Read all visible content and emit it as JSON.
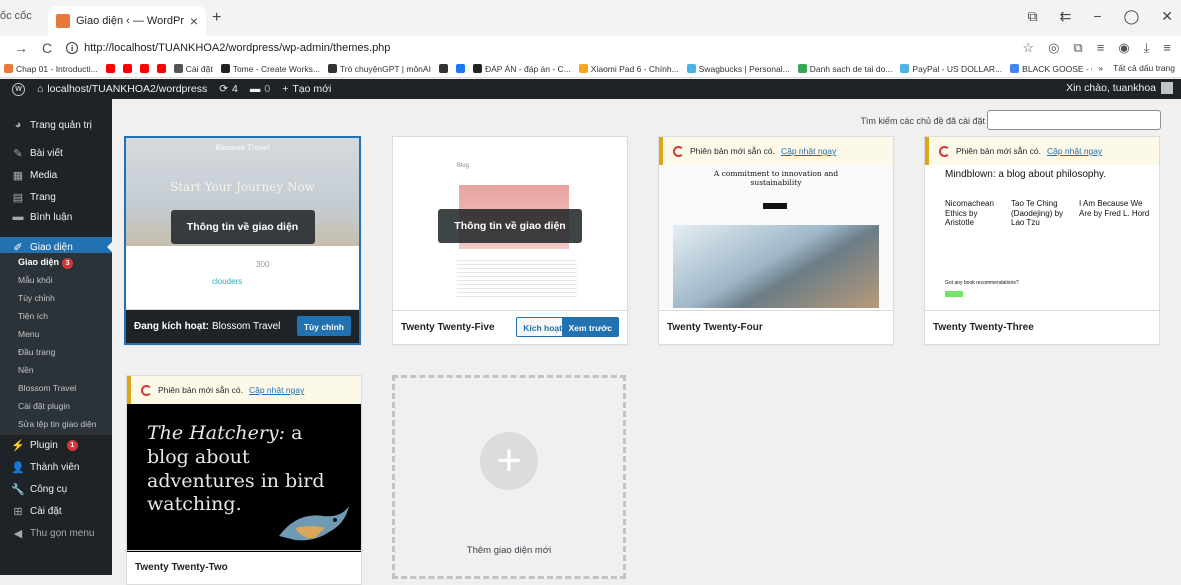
{
  "browser": {
    "prev_tab_text": "ốc cốc",
    "active_tab_title": "Giao diện ‹ — WordPress",
    "url": "http://localhost/TUANKHOA2/wordpress/wp-admin/themes.php",
    "bookmarks": [
      {
        "label": "Chap 01 - Introducti...",
        "color": "#e8793b"
      },
      {
        "label": "",
        "color": "#ff0000"
      },
      {
        "label": "",
        "color": "#ff0000"
      },
      {
        "label": "",
        "color": "#ff0000"
      },
      {
        "label": "",
        "color": "#ff0000"
      },
      {
        "label": "Cài đặt",
        "color": "#555555"
      },
      {
        "label": "Tome - Create Works...",
        "color": "#222222"
      },
      {
        "label": "Trò chuyệnGPT | mônAI",
        "color": "#333333"
      },
      {
        "label": "",
        "color": "#333333"
      },
      {
        "label": "",
        "color": "#1877f2"
      },
      {
        "label": "ĐÁP ÁN - đáp án - C...",
        "color": "#222222"
      },
      {
        "label": "Xiaomi Pad 6 - Chính...",
        "color": "#f5a623"
      },
      {
        "label": "Swagbucks | Personal...",
        "color": "#4ab4e6"
      },
      {
        "label": "Danh sach de tai do...",
        "color": "#34a853"
      },
      {
        "label": "PayPal - US DOLLAR...",
        "color": "#4ab4e6"
      },
      {
        "label": "BLACK GOOSE - Goo...",
        "color": "#4285f4"
      }
    ],
    "bookmarks_more": "»",
    "all_bookmarks_label": "Tất cả dấu trang"
  },
  "adminbar": {
    "site": "localhost/TUANKHOA2/wordpress",
    "updates": "4",
    "comments": "0",
    "new_label": "Tạo mới",
    "greeting": "Xin chào, tuankhoa"
  },
  "sidebar": {
    "items": [
      {
        "label": "Trang quản trị",
        "icon": "dashboard-icon",
        "glyph": "◕"
      },
      {
        "label": "Bài viết",
        "icon": "pin-icon",
        "glyph": "✎"
      },
      {
        "label": "Media",
        "icon": "media-icon",
        "glyph": "▦"
      },
      {
        "label": "Trang",
        "icon": "page-icon",
        "glyph": "▤"
      },
      {
        "label": "Bình luận",
        "icon": "comment-icon",
        "glyph": "▬"
      },
      {
        "label": "Giao diện",
        "icon": "appearance-icon",
        "glyph": "✐"
      }
    ],
    "submenu": [
      "Giao diện",
      "Mẫu khối",
      "Tùy chỉnh",
      "Tiện ích",
      "Menu",
      "Đầu trang",
      "Nền",
      "Blossom Travel",
      "Cài đặt plugin",
      "Sửa tệp tin giao diện"
    ],
    "submenu_badge": "3",
    "bottom_items": [
      {
        "label": "Plugin",
        "icon": "plugin-icon",
        "glyph": "⚡",
        "badge": "1"
      },
      {
        "label": "Thành viên",
        "icon": "users-icon",
        "glyph": "👤"
      },
      {
        "label": "Công cụ",
        "icon": "tools-icon",
        "glyph": "🔧"
      },
      {
        "label": "Cài đặt",
        "icon": "settings-icon",
        "glyph": "⊞"
      },
      {
        "label": "Thu gọn menu",
        "icon": "collapse-icon",
        "glyph": "◀"
      }
    ]
  },
  "main": {
    "search_label": "Tìm kiếm các chủ đề đã cài đặt",
    "search_value": "",
    "overlay_label": "Thông tin về giao diện",
    "update_text": "Phiên bản mới sẵn có.",
    "update_link": "Cập nhật ngay",
    "themes": {
      "blossom": {
        "active_label": "Đang kích hoạt:",
        "name": "Blossom Travel",
        "customize": "Tùy chỉnh",
        "hero_text": "Start Your Journey Now",
        "logo_text": "Blossom Travel",
        "footer_text": "clouders",
        "footer_num": "300"
      },
      "tt5": {
        "name": "Twenty Twenty-Five",
        "activate": "Kích hoạt",
        "preview": "Xem trước",
        "shot_blog": "Blog"
      },
      "tt4": {
        "name": "Twenty Twenty-Four",
        "headline": "A commitment to innovation and sustainability"
      },
      "tt3": {
        "name": "Twenty Twenty-Three",
        "headline": "Mindblown: a blog about philosophy.",
        "col1": "Nicomachean Ethics by Aristotle",
        "col2": "Tao Te Ching (Daodejing) by Lao Tzu",
        "col3": "I Am Because We Are by Fred L. Hord",
        "footer_q": "Got any book recommendations?"
      },
      "tt2": {
        "name": "Twenty Twenty-Two",
        "headline_italic": "The Hatchery:",
        "headline_rest": "a blog about adventures in bird watching."
      }
    },
    "add_new_label": "Thêm giao diện mới"
  }
}
